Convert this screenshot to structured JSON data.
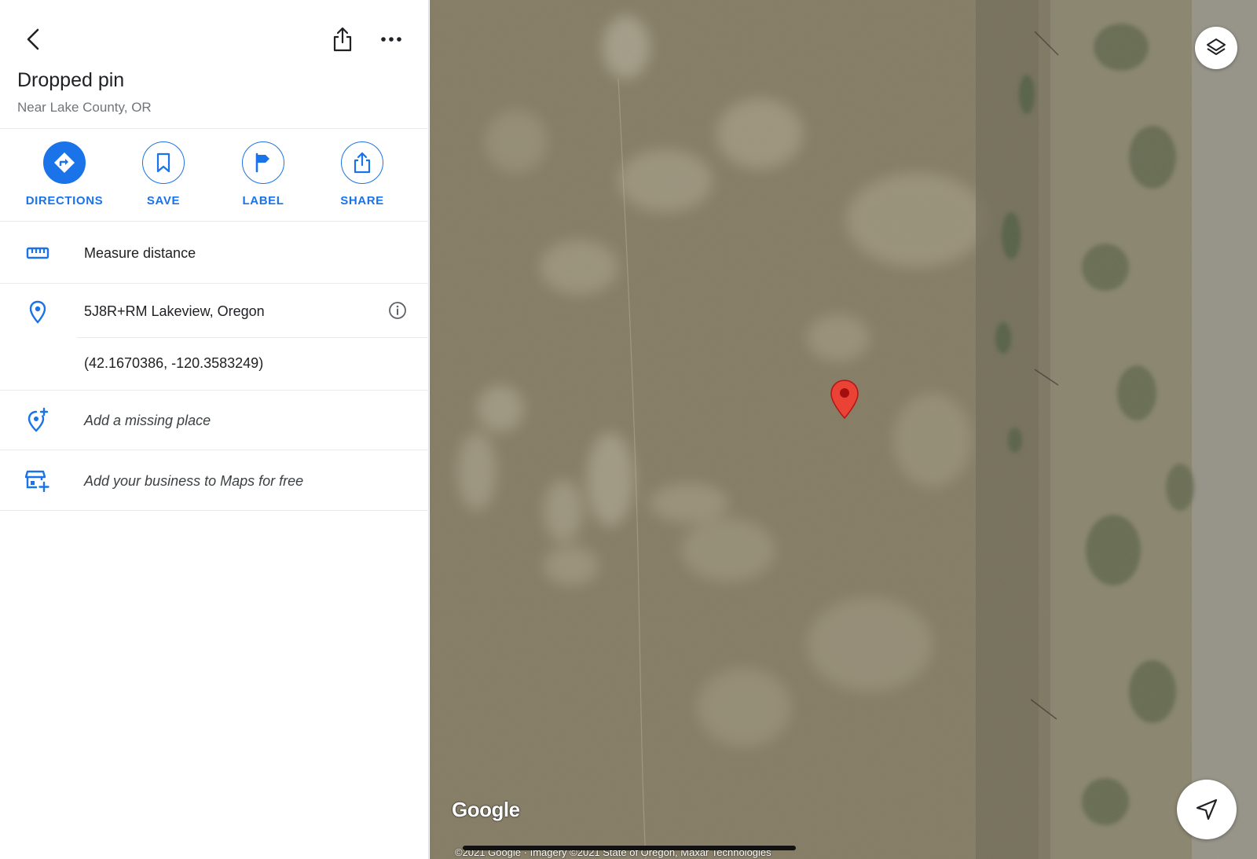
{
  "place": {
    "title": "Dropped pin",
    "subtitle": "Near Lake County, OR"
  },
  "actions": [
    {
      "label": "DIRECTIONS",
      "icon": "directions-icon"
    },
    {
      "label": "SAVE",
      "icon": "bookmark-icon"
    },
    {
      "label": "LABEL",
      "icon": "flag-icon"
    },
    {
      "label": "SHARE",
      "icon": "share-icon"
    }
  ],
  "rows": {
    "measure": "Measure distance",
    "plus_code": "5J8R+RM Lakeview, Oregon",
    "coordinates": "(42.1670386, -120.3583249)",
    "add_place": "Add a missing place",
    "add_business": "Add your business to Maps for free"
  },
  "map": {
    "logo": "Google",
    "attribution": "©2021 Google · Imagery ©2021 State of Oregon, Maxar Technologies"
  },
  "colors": {
    "accent": "#1a73e8",
    "pin": "#ea4335",
    "text": "#202124",
    "secondary_text": "#70757a"
  }
}
